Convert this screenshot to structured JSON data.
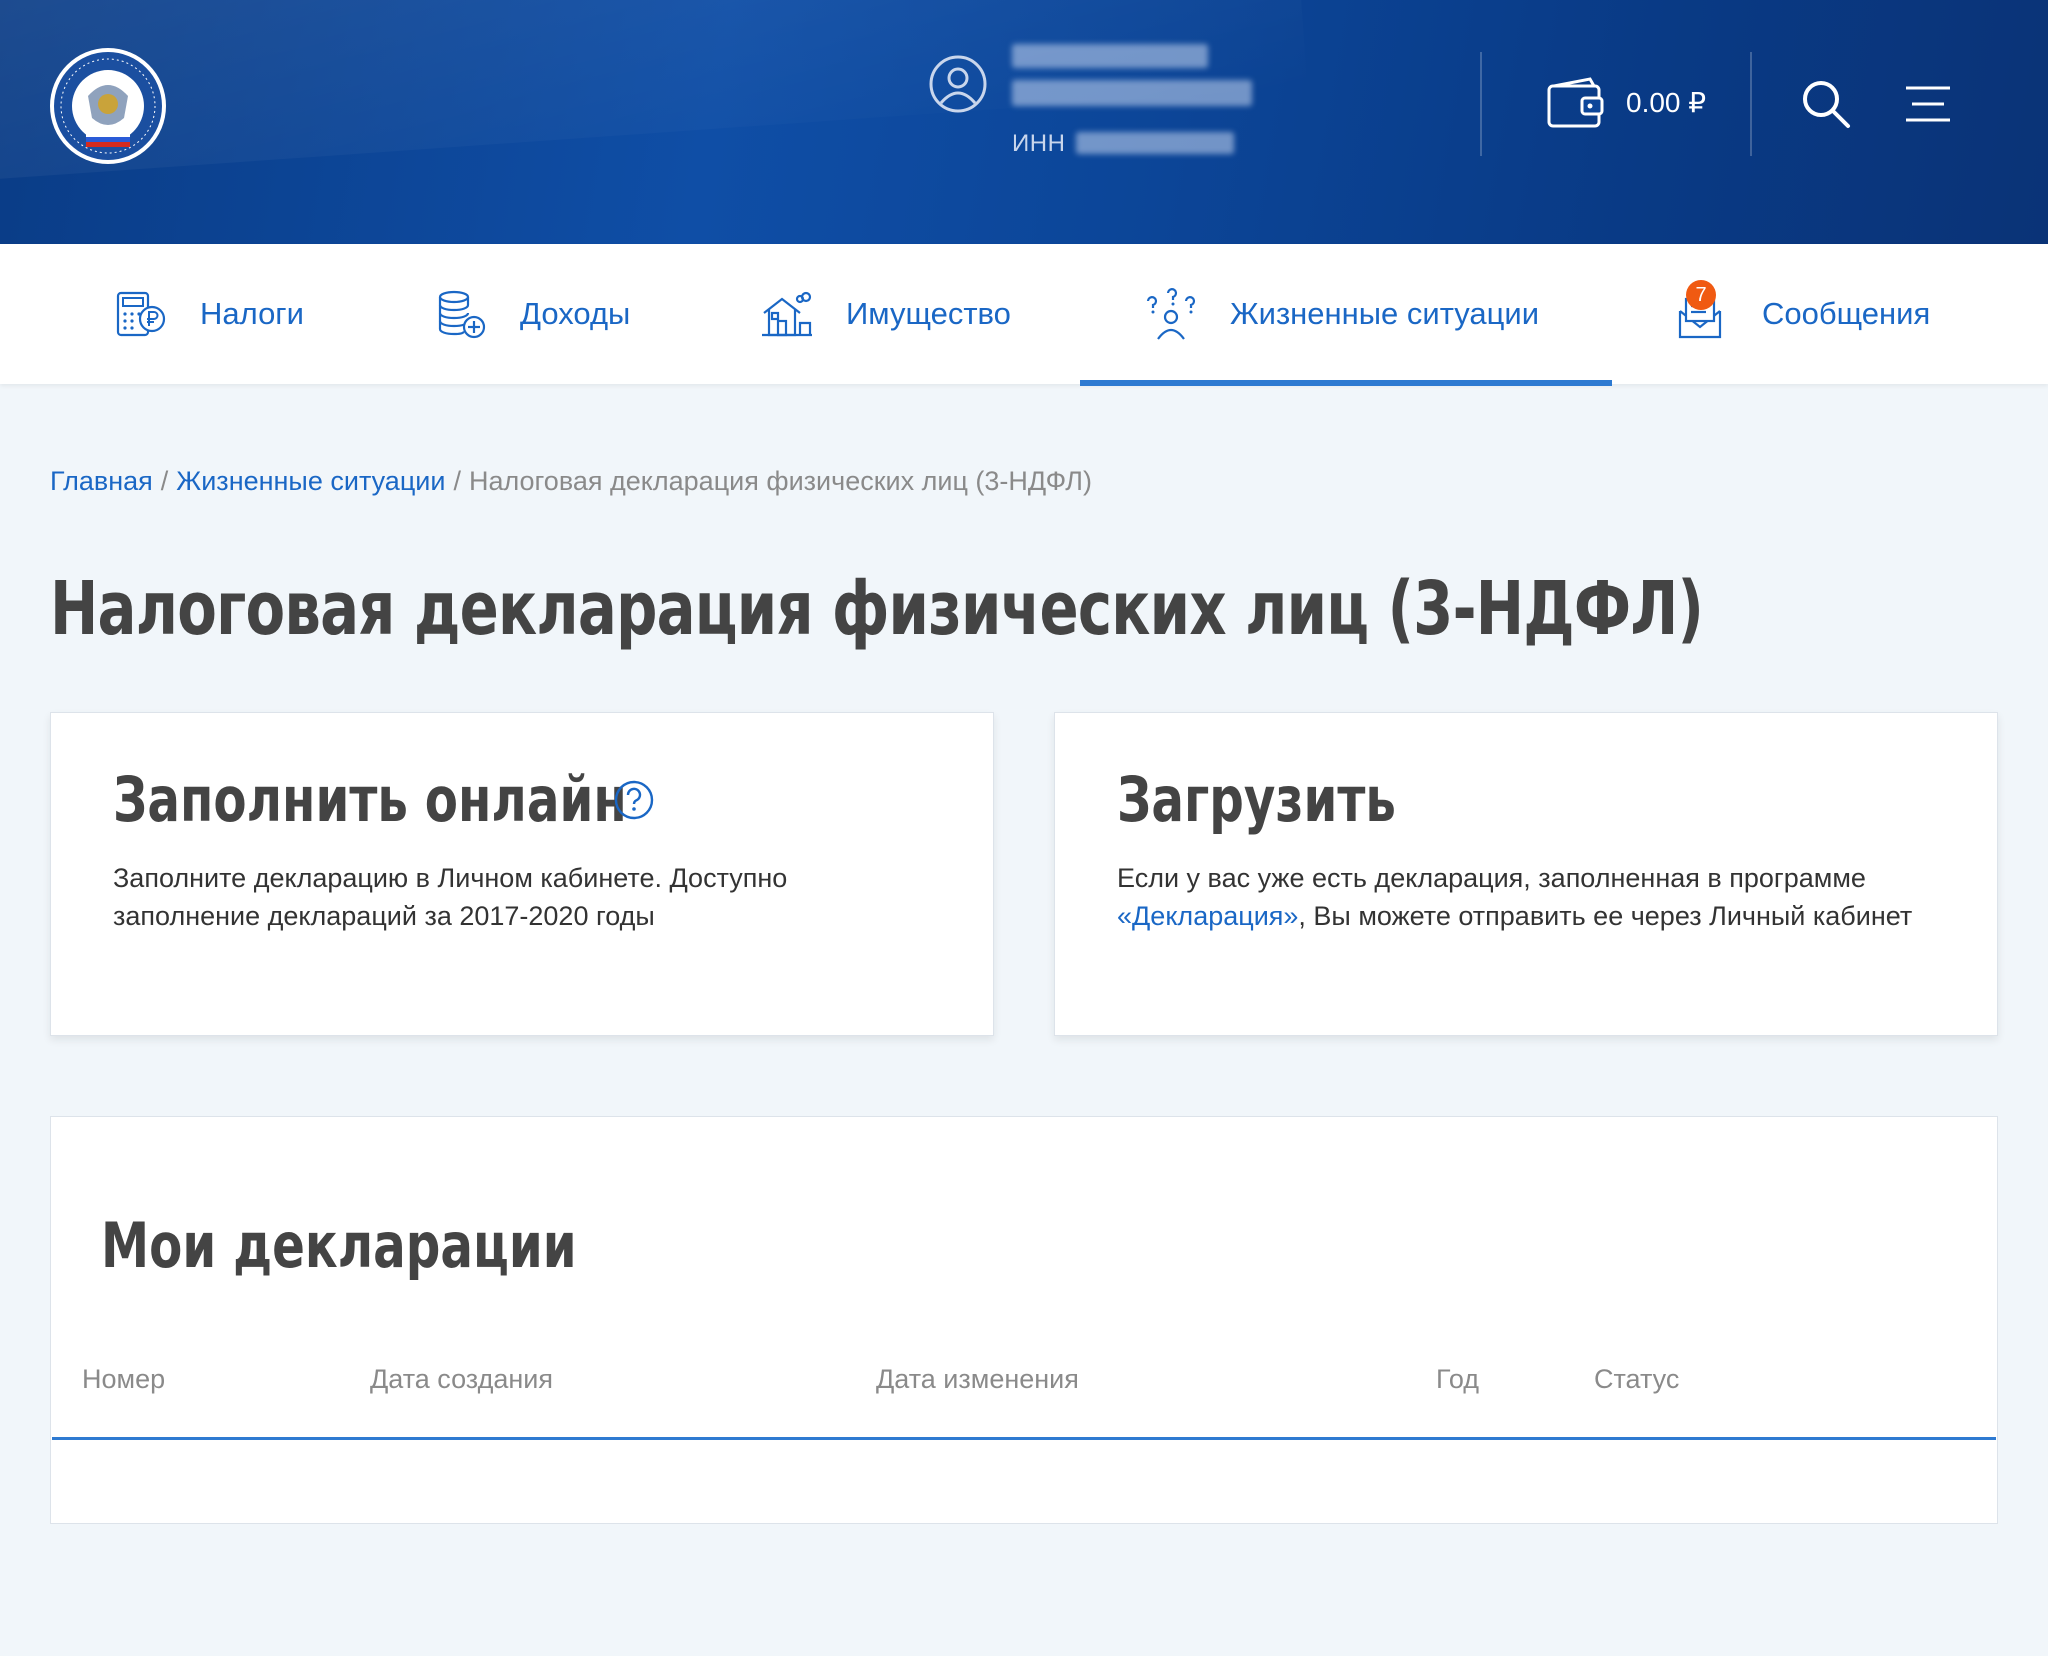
{
  "header": {
    "inn_label": "ИНН",
    "balance": "0.00 ₽"
  },
  "nav": {
    "items": [
      {
        "label": "Налоги",
        "icon": "calculator-ruble-icon"
      },
      {
        "label": "Доходы",
        "icon": "coins-plus-icon"
      },
      {
        "label": "Имущество",
        "icon": "house-icon"
      },
      {
        "label": "Жизненные ситуации",
        "icon": "person-questions-icon",
        "active": true
      },
      {
        "label": "Сообщения",
        "icon": "envelope-icon",
        "badge": "7"
      }
    ]
  },
  "breadcrumb": {
    "home": "Главная",
    "section": "Жизненные ситуации",
    "current": "Налоговая декларация физических лиц (3-НДФЛ)",
    "separator": "/"
  },
  "page": {
    "title": "Налоговая декларация физических лиц (3-НДФЛ)"
  },
  "cards": {
    "online": {
      "title": "Заполнить онлайн",
      "text": "Заполните декларацию в Личном кабинете. Доступно заполнение деклараций за 2017-2020 годы"
    },
    "upload": {
      "title": "Загрузить",
      "text_before": "Если у вас уже есть декларация, заполненная в программе ",
      "link": "«Декларация»",
      "text_after": ", Вы можете отправить ее через Личный кабинет"
    }
  },
  "declarations": {
    "title": "Мои декларации",
    "columns": [
      "Номер",
      "Дата создания",
      "Дата изменения",
      "Год",
      "Статус"
    ],
    "rows": []
  }
}
